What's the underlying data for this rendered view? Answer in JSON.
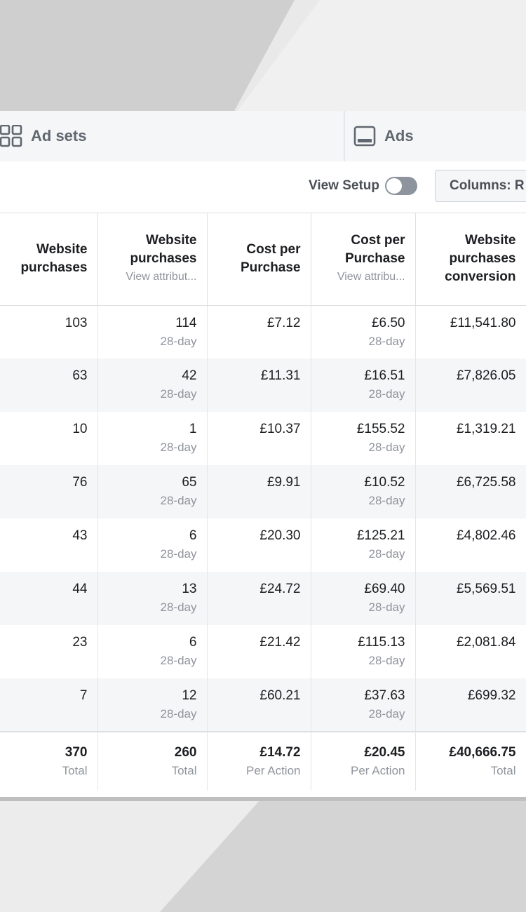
{
  "tabs": {
    "adsets_label": "Ad sets",
    "ads_label": "Ads"
  },
  "toolbar": {
    "view_setup_label": "View Setup",
    "view_setup_on": false,
    "columns_label": "Columns: R"
  },
  "table": {
    "headers": [
      {
        "label": "Website purchases",
        "sub": ""
      },
      {
        "label": "Website purchases",
        "sub": "View attribut..."
      },
      {
        "label": "Cost per Purchase",
        "sub": ""
      },
      {
        "label": "Cost per Purchase",
        "sub": "View attribu..."
      },
      {
        "label": "Website purchases conversion",
        "sub": ""
      }
    ],
    "rows": [
      [
        {
          "v": "103",
          "s": ""
        },
        {
          "v": "114",
          "s": "28-day"
        },
        {
          "v": "£7.12",
          "s": ""
        },
        {
          "v": "£6.50",
          "s": "28-day"
        },
        {
          "v": "£11,541.80",
          "s": ""
        }
      ],
      [
        {
          "v": "63",
          "s": ""
        },
        {
          "v": "42",
          "s": "28-day"
        },
        {
          "v": "£11.31",
          "s": ""
        },
        {
          "v": "£16.51",
          "s": "28-day"
        },
        {
          "v": "£7,826.05",
          "s": ""
        }
      ],
      [
        {
          "v": "10",
          "s": ""
        },
        {
          "v": "1",
          "s": "28-day"
        },
        {
          "v": "£10.37",
          "s": ""
        },
        {
          "v": "£155.52",
          "s": "28-day"
        },
        {
          "v": "£1,319.21",
          "s": ""
        }
      ],
      [
        {
          "v": "76",
          "s": ""
        },
        {
          "v": "65",
          "s": "28-day"
        },
        {
          "v": "£9.91",
          "s": ""
        },
        {
          "v": "£10.52",
          "s": "28-day"
        },
        {
          "v": "£6,725.58",
          "s": ""
        }
      ],
      [
        {
          "v": "43",
          "s": ""
        },
        {
          "v": "6",
          "s": "28-day"
        },
        {
          "v": "£20.30",
          "s": ""
        },
        {
          "v": "£125.21",
          "s": "28-day"
        },
        {
          "v": "£4,802.46",
          "s": ""
        }
      ],
      [
        {
          "v": "44",
          "s": ""
        },
        {
          "v": "13",
          "s": "28-day"
        },
        {
          "v": "£24.72",
          "s": ""
        },
        {
          "v": "£69.40",
          "s": "28-day"
        },
        {
          "v": "£5,569.51",
          "s": ""
        }
      ],
      [
        {
          "v": "23",
          "s": ""
        },
        {
          "v": "6",
          "s": "28-day"
        },
        {
          "v": "£21.42",
          "s": ""
        },
        {
          "v": "£115.13",
          "s": "28-day"
        },
        {
          "v": "£2,081.84",
          "s": ""
        }
      ],
      [
        {
          "v": "7",
          "s": ""
        },
        {
          "v": "12",
          "s": "28-day"
        },
        {
          "v": "£60.21",
          "s": ""
        },
        {
          "v": "£37.63",
          "s": "28-day"
        },
        {
          "v": "£699.32",
          "s": ""
        }
      ]
    ],
    "totals": [
      {
        "v": "370",
        "s": "Total"
      },
      {
        "v": "260",
        "s": "Total"
      },
      {
        "v": "£14.72",
        "s": "Per Action"
      },
      {
        "v": "£20.45",
        "s": "Per Action"
      },
      {
        "v": "£40,666.75",
        "s": "Total"
      }
    ]
  }
}
